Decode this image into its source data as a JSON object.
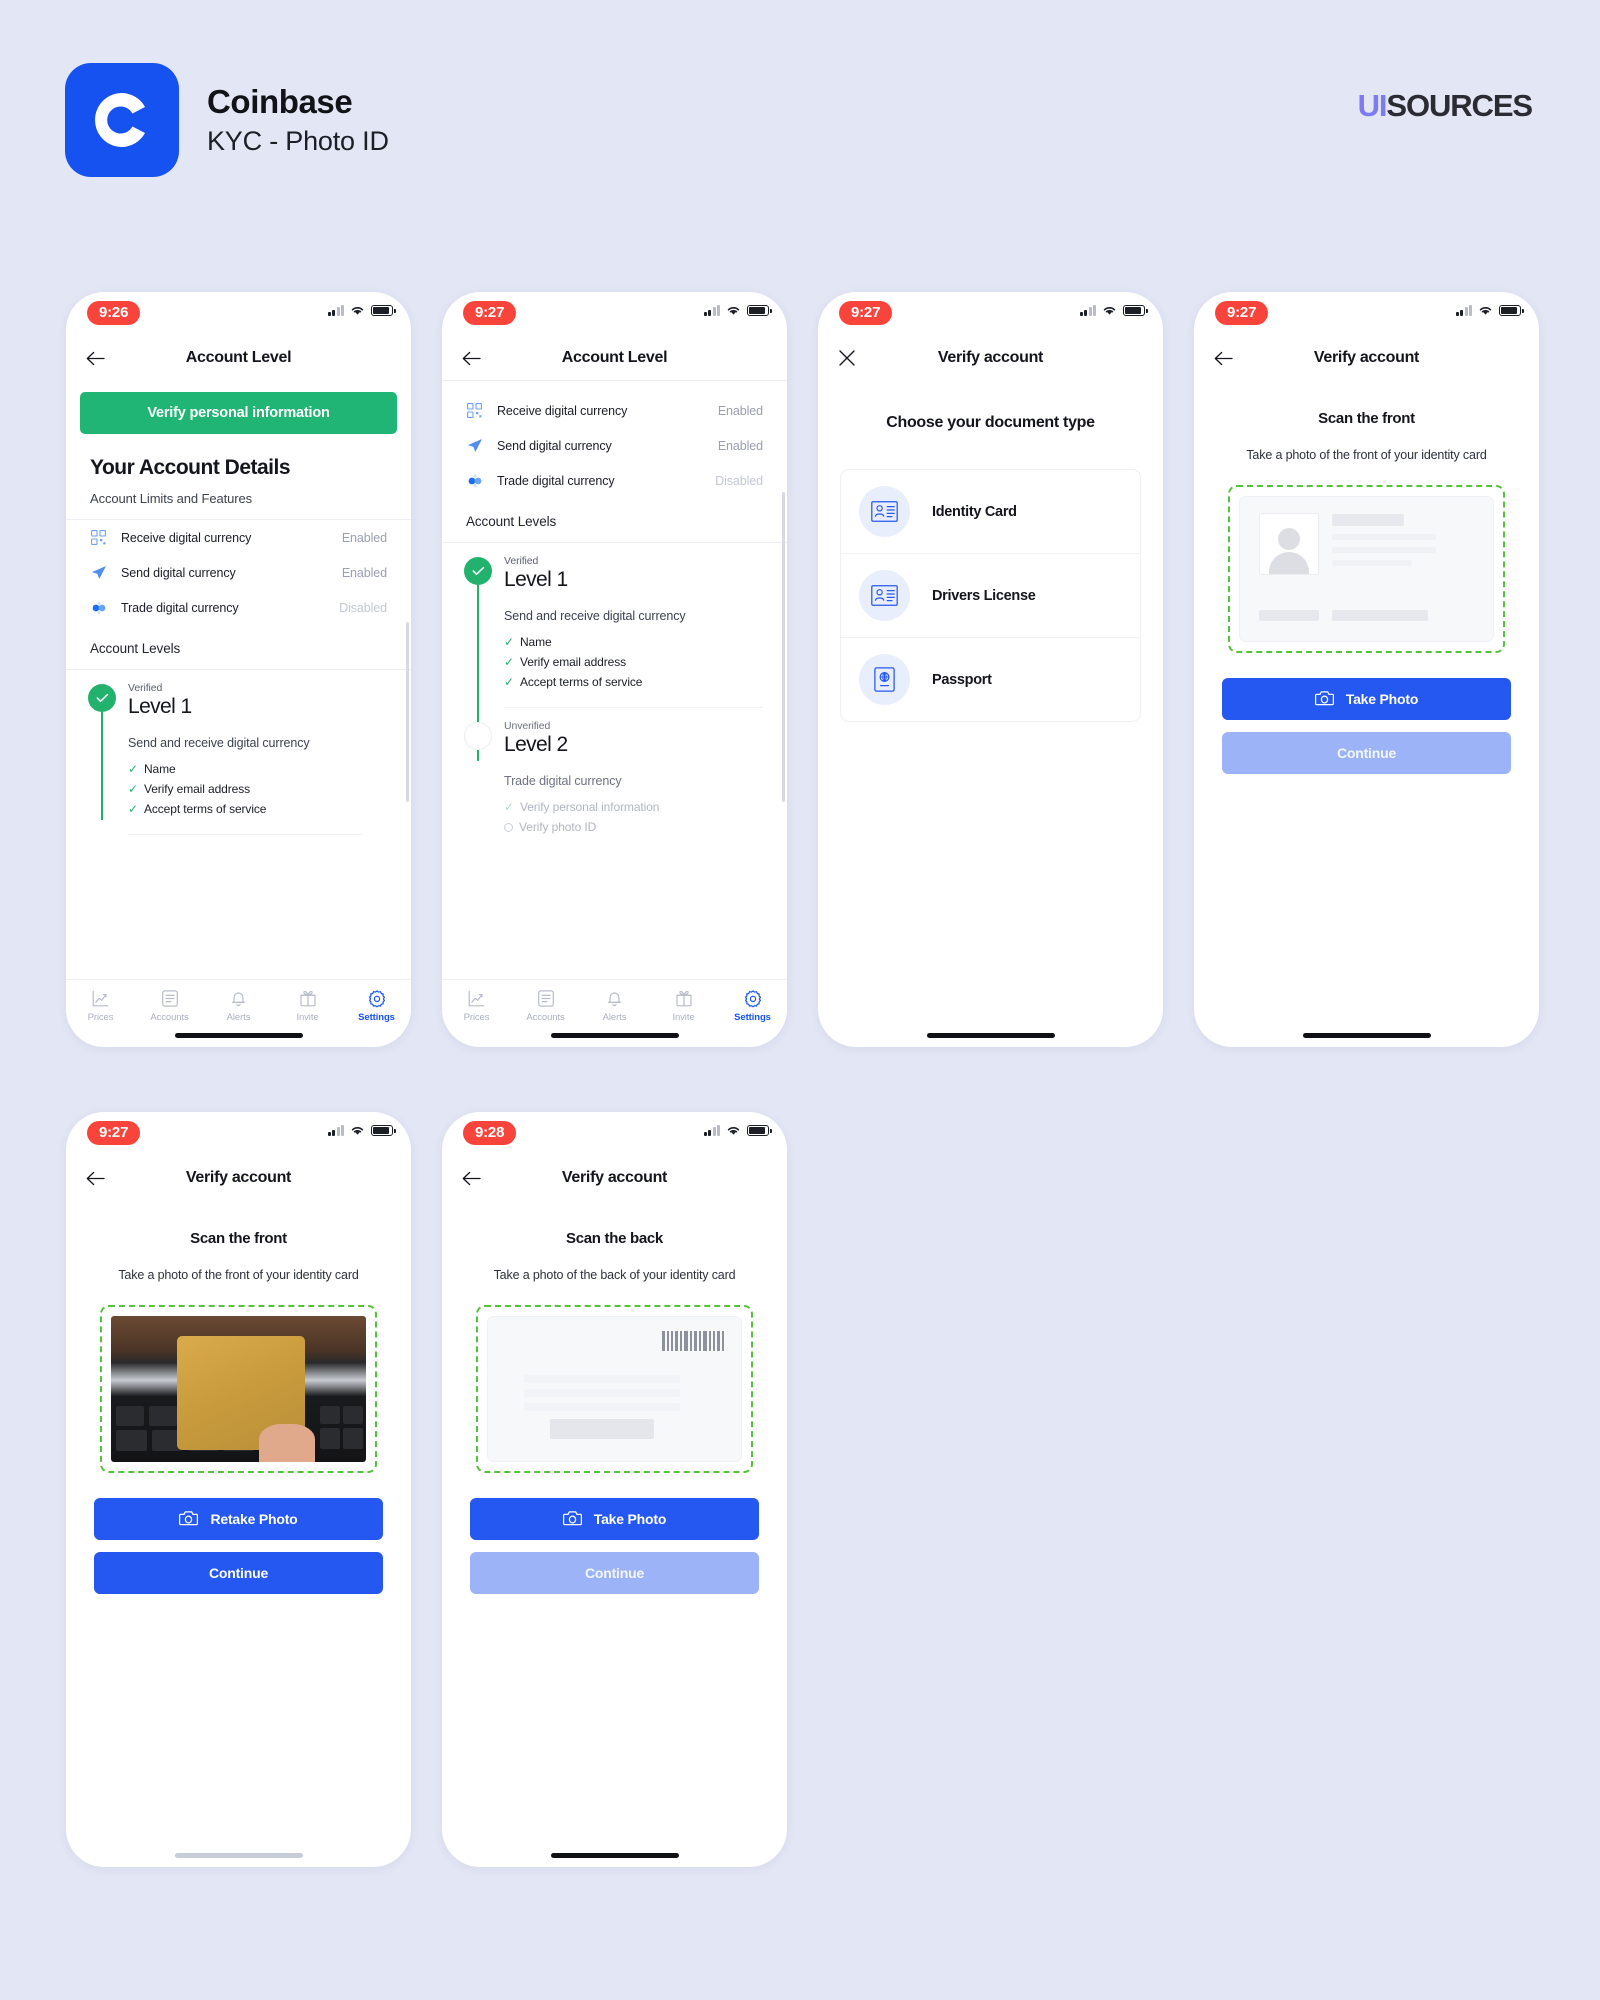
{
  "header": {
    "app_name": "Coinbase",
    "flow_name": "KYC - Photo ID",
    "logo_letter": "C",
    "watermark_ui": "UI",
    "watermark_sources": "SOURCES",
    "brand_color": "#1652f0",
    "accent_purple": "#7c7cf0"
  },
  "common": {
    "tabs": [
      {
        "label": "Prices",
        "icon": "chart-line-icon",
        "active": false
      },
      {
        "label": "Accounts",
        "icon": "list-icon",
        "active": false
      },
      {
        "label": "Alerts",
        "icon": "bell-icon",
        "active": false
      },
      {
        "label": "Invite",
        "icon": "gift-icon",
        "active": false
      },
      {
        "label": "Settings",
        "icon": "gear-icon",
        "active": true
      }
    ],
    "enabled_label": "Enabled",
    "disabled_label": "Disabled",
    "back_icon": "back-arrow-icon",
    "close_icon": "close-x-icon",
    "camera_icon": "camera-icon"
  },
  "screen1": {
    "time": "9:26",
    "nav_title": "Account Level",
    "cta_label": "Verify personal information",
    "cta_color": "#20b574",
    "section_title": "Your Account Details",
    "section_sub": "Account Limits and Features",
    "features": [
      {
        "label": "Receive digital currency",
        "status": "Enabled",
        "icon": "qr-code-icon",
        "muted": false
      },
      {
        "label": "Send digital currency",
        "status": "Enabled",
        "icon": "send-paper-plane-icon",
        "muted": false
      },
      {
        "label": "Trade digital currency",
        "status": "Disabled",
        "icon": "trade-dots-icon",
        "muted": true
      }
    ],
    "levels_heading": "Account Levels",
    "level": {
      "status": "Verified",
      "name": "Level 1",
      "desc": "Send and receive digital currency",
      "reqs": [
        "Name",
        "Verify email address",
        "Accept terms of service"
      ]
    }
  },
  "screen2": {
    "time": "9:27",
    "nav_title": "Account Level",
    "features": [
      {
        "label": "Receive digital currency",
        "status": "Enabled",
        "icon": "qr-code-icon",
        "muted": false
      },
      {
        "label": "Send digital currency",
        "status": "Enabled",
        "icon": "send-paper-plane-icon",
        "muted": false
      },
      {
        "label": "Trade digital currency",
        "status": "Disabled",
        "icon": "trade-dots-icon",
        "muted": true
      }
    ],
    "levels_heading": "Account Levels",
    "level1": {
      "status": "Verified",
      "name": "Level 1",
      "desc": "Send and receive digital currency",
      "reqs": [
        "Name",
        "Verify email address",
        "Accept terms of service"
      ]
    },
    "level2": {
      "status": "Unverified",
      "name": "Level 2",
      "desc": "Trade digital currency",
      "req_done": "Verify personal information",
      "req_todo": "Verify photo ID"
    }
  },
  "screen3": {
    "time": "9:27",
    "nav_title": "Verify account",
    "prompt": "Choose your document type",
    "options": [
      {
        "label": "Identity Card",
        "icon": "id-card-icon"
      },
      {
        "label": "Drivers License",
        "icon": "id-card-icon"
      },
      {
        "label": "Passport",
        "icon": "passport-globe-icon"
      }
    ]
  },
  "screen4": {
    "time": "9:27",
    "nav_title": "Verify account",
    "title": "Scan the front",
    "sub": "Take a photo of the front of your identity card",
    "primary_btn": "Take Photo",
    "secondary_btn": "Continue",
    "secondary_disabled": true,
    "frame_color": "#54c23a"
  },
  "screen5": {
    "time": "9:27",
    "nav_title": "Verify account",
    "title": "Scan the front",
    "sub": "Take a photo of the front of your identity card",
    "primary_btn": "Retake Photo",
    "secondary_btn": "Continue",
    "secondary_disabled": false,
    "frame_color": "#54c23a"
  },
  "screen6": {
    "time": "9:28",
    "nav_title": "Verify account",
    "title": "Scan the back",
    "sub": "Take a photo of the back of your identity card",
    "primary_btn": "Take Photo",
    "secondary_btn": "Continue",
    "secondary_disabled": true,
    "frame_color": "#54c23a"
  }
}
